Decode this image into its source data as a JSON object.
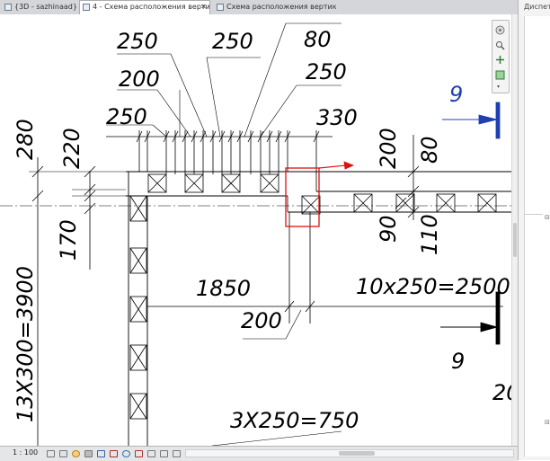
{
  "tabs": [
    {
      "label": "{3D - sazhinaad}",
      "active": false
    },
    {
      "label": "4 - Схема расположения верти...",
      "active": true
    },
    {
      "label": "Схема расположения вертикальн...",
      "active": false
    }
  ],
  "right_panel": {
    "title": "Диспет"
  },
  "drawing": {
    "dims": {
      "d250a": "250",
      "d250b": "250",
      "d80a": "80",
      "d200a": "200",
      "d250c": "250",
      "d250d": "250",
      "d330": "330",
      "d280": "280",
      "d220": "220",
      "d170": "170",
      "d200b": "200",
      "d80b": "80",
      "d90": "90",
      "d110": "110",
      "d1850": "1850",
      "d200c": "200",
      "d10x250": "10x250=2500",
      "d13x300": "13X300=3900",
      "d3x250": "3X250=750",
      "d20": "20"
    },
    "section_mark_top": "9",
    "section_mark_bottom": "9"
  },
  "status": {
    "scale": "1 : 100"
  },
  "colors": {
    "section_mark": "#1f3fb4",
    "highlight": "#e01010"
  }
}
